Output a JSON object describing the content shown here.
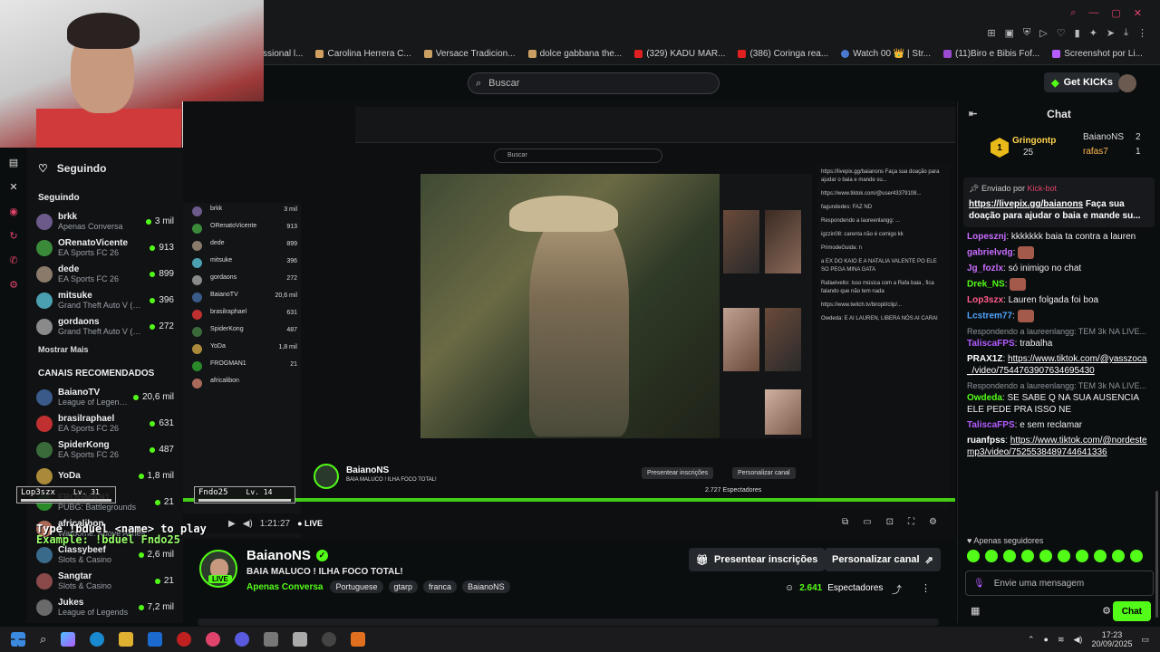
{
  "bookmarks": [
    "ssional l...",
    "Carolina Herrera C...",
    "Versace Tradicion...",
    "dolce gabbana the...",
    "(329) KADU MAR...",
    "(386) Coringa rea...",
    "Watch 00 👑 | Str...",
    "(11)Biro e Bibis Fof...",
    "Screenshot por Li..."
  ],
  "header": {
    "search_placeholder": "Buscar",
    "get_kicks": "Get KICKs"
  },
  "sidebar": {
    "title": "Seguindo",
    "following_title": "Seguindo",
    "following": [
      {
        "name": "brkk",
        "game": "Apenas Conversa",
        "viewers": "3 mil",
        "color": "#6b5a8a"
      },
      {
        "name": "ORenatoVicente",
        "game": "EA Sports FC 26",
        "viewers": "913",
        "color": "#3a8a3a"
      },
      {
        "name": "dede",
        "game": "EA Sports FC 26",
        "viewers": "899",
        "color": "#8a7a6a"
      },
      {
        "name": "mitsuke",
        "game": "Grand Theft Auto V (G...",
        "viewers": "396",
        "color": "#4aa0b0"
      },
      {
        "name": "gordaons",
        "game": "Grand Theft Auto V (G...",
        "viewers": "272",
        "color": "#8a8a8a"
      }
    ],
    "show_more": "Mostrar Mais",
    "recommended_title": "CANAIS RECOMENDADOS",
    "recommended": [
      {
        "name": "BaianoTV",
        "game": "League of Legends",
        "viewers": "20,6 mil",
        "color": "#3a5a8a"
      },
      {
        "name": "brasilraphael",
        "game": "EA Sports FC 26",
        "viewers": "631",
        "color": "#c03030"
      },
      {
        "name": "SpiderKong",
        "game": "EA Sports FC 26",
        "viewers": "487",
        "color": "#3a6a3a"
      },
      {
        "name": "YoDa",
        "game": "",
        "viewers": "1,8 mil",
        "color": "#aa8a3a"
      },
      {
        "name": "FROGMAN1",
        "game": "PUBG: Battlegrounds",
        "viewers": "21",
        "color": "#2a8a2a"
      },
      {
        "name": "africalibon",
        "game": "Warborne: Above Ashes",
        "viewers": "",
        "color": "#aa6a5a"
      },
      {
        "name": "Classybeef",
        "game": "Slots & Casino",
        "viewers": "2,6 mil",
        "color": "#3a6a8a"
      },
      {
        "name": "Sangtar",
        "game": "Slots & Casino",
        "viewers": "21",
        "color": "#8a4a4a"
      },
      {
        "name": "Jukes",
        "game": "League of Legends",
        "viewers": "7,2 mil",
        "color": "#6a6a6a"
      }
    ]
  },
  "game_overlay": {
    "tag1_name": "Lop3szx",
    "tag1_level": "Lv. 31",
    "tag2_name": "Fndo25",
    "tag2_level": "Lv. 14",
    "line1": "Type !bduel <name> to play",
    "line2": "Example: !bduel Fndo25"
  },
  "nested": {
    "search": "Buscar",
    "channel_name": "BaianoNS",
    "channel_title": "BAIA MALUCO ! ILHA FOCO TOTAL!",
    "gift_btn": "Presentear inscrições",
    "custom_btn": "Personalizar canal",
    "viewers": "2.727 Espectadores",
    "chat_lines": [
      "https://livepix.gg/baianons Faça sua doação para ajudar o baia e mande su...",
      "https://www.tiktok.com/@user43379108...",
      "fagundedes: FAZ ND",
      "Respondendo a laureenlangg: ...",
      "igzzin08: carenta não é comigo kk",
      "PrimodeGuida: n",
      "a EX DO KAIO E A NATALIA VALENTE PO ELE SO PEGA MINA GATA",
      "Rafaelvelto: Isso música com a Rafa baia , fica falando que não tem nada",
      "https://www.twitch.tv/biropil/clip/...",
      "Owdeda: E AI LAUREN, LIBERA NÓS AI CARAI"
    ]
  },
  "stream_ctrl": {
    "time": "1:21:27",
    "live": "LIVE"
  },
  "channel": {
    "name": "BaianoNS",
    "live_badge": "LIVE",
    "title": "BAIA MALUCO ! ILHA FOCO TOTAL!",
    "category": "Apenas Conversa",
    "tags": [
      "Portuguese",
      "gtarp",
      "franca",
      "BaianoNS"
    ],
    "gift_btn": "Presentear inscrições",
    "custom_btn": "Personalizar canal",
    "viewers_num": "2.641",
    "viewers_label": "Espectadores"
  },
  "chat": {
    "title": "Chat",
    "leaderboard": {
      "first_name": "Gringontp",
      "first_count": "25",
      "rank": "1",
      "second_name": "BaianoNS",
      "second_count": "2",
      "third_name": "rafas7",
      "third_count": "1"
    },
    "pinned": {
      "by_label": "Enviado por",
      "by_user": "Kick-bot",
      "link": "https://livepix.gg/baianons",
      "text": "Faça sua doação para ajudar o baia e mande su..."
    },
    "messages": [
      {
        "user": "Lopesznj",
        "color": "#c86cff",
        "text": "kkkkkkk baia ta contra a lauren",
        "reply": ""
      },
      {
        "user": "gabrielvdg",
        "color": "#c86cff",
        "text": "",
        "reply": "",
        "emote": true
      },
      {
        "user": "Jg_fozlx",
        "color": "#c86cff",
        "text": "só inimigo no chat",
        "reply": ""
      },
      {
        "user": "Drek_NS",
        "color": "#53fc18",
        "text": "",
        "reply": "",
        "emote": true
      },
      {
        "user": "Lop3szx",
        "color": "#ff5a8a",
        "text": "Lauren folgada foi boa",
        "reply": ""
      },
      {
        "user": "Lcstrem77",
        "color": "#4fa3ff",
        "text": "",
        "reply": "",
        "emote": true
      },
      {
        "user": "TaliscaFPS",
        "color": "#b45cff",
        "text": "trabalha",
        "reply": "Respondendo a laureenlangg: TEM 3k NA LIVE..."
      },
      {
        "user": "PRAX1Z",
        "color": "#ffffff",
        "text": "https://www.tiktok.com/@yasszoca_/video/7544763907634695430",
        "reply": "",
        "link": true
      },
      {
        "user": "Owdeda",
        "color": "#53fc18",
        "text": "SE SABE Q NA SUA AUSENCIA ELE PEDE PRA ISSO NE",
        "reply": "Respondendo a laureenlangg: TEM 3k NA LIVE..."
      },
      {
        "user": "TaliscaFPS",
        "color": "#b45cff",
        "text": "e sem reclamar",
        "reply": ""
      },
      {
        "user": "ruanfpss",
        "color": "#ffffff",
        "text": "https://www.tiktok.com/@nordestemp3/video/7525538489744641336",
        "reply": "",
        "link": true
      }
    ],
    "supporters": "Apenas seguidores",
    "input_placeholder": "Envie uma mensagem",
    "send": "Chat"
  },
  "taskbar": {
    "time": "17:23",
    "date": "20/09/2025"
  }
}
